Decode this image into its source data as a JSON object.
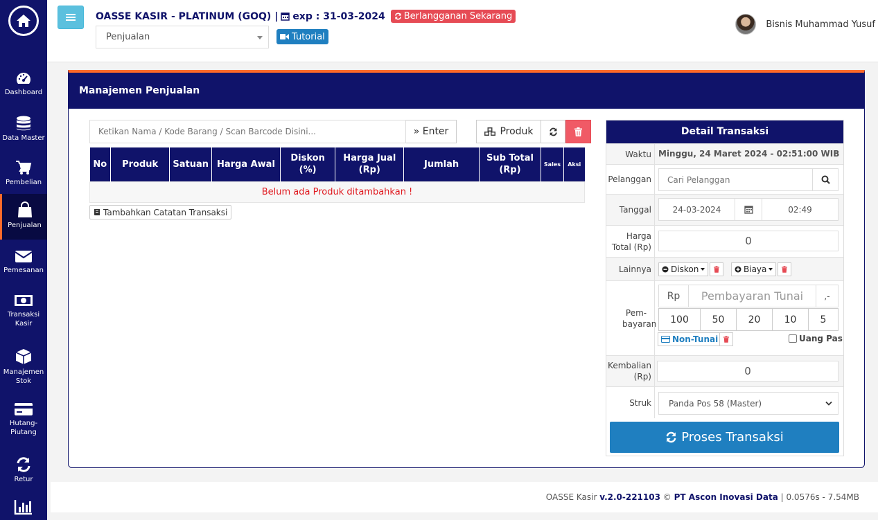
{
  "sidebar": {
    "items": [
      {
        "label": "Dashboard",
        "icon": "dashboard-icon"
      },
      {
        "label": "Data Master",
        "icon": "database-icon"
      },
      {
        "label": "Pembelian",
        "icon": "cart-icon"
      },
      {
        "label": "Penjualan",
        "icon": "shopping-bag-icon"
      },
      {
        "label": "Pemesanan",
        "icon": "envelope-icon"
      },
      {
        "label": "Transaksi Kasir",
        "icon": "money-icon"
      },
      {
        "label": "Manajemen Stok",
        "icon": "cube-icon"
      },
      {
        "label": "Hutang-Piutang",
        "icon": "credit-card-icon"
      },
      {
        "label": "Retur",
        "icon": "refresh-icon"
      },
      {
        "label": "",
        "icon": "bar-chart-icon"
      }
    ]
  },
  "topbar": {
    "title": "OASSE KASIR - PLATINUM (GOQ) |",
    "exp": "exp : 31-03-2024",
    "subscribe": "Berlangganan Sekarang",
    "module_select": "Penjualan",
    "tutorial": "Tutorial",
    "user_name": "Bisnis Muhammad Yusuf"
  },
  "panel": {
    "title": "Manajemen Penjualan",
    "search_placeholder": "Ketikan Nama / Kode Barang / Scan Barcode Disini...",
    "enter_label": "» Enter",
    "produk_label": "Produk",
    "table": {
      "headers": [
        "No",
        "Produk",
        "Satuan",
        "Harga Awal",
        "Diskon (%)",
        "Harga Jual (Rp)",
        "Jumlah",
        "Sub Total (Rp)",
        "Sales",
        "Aksi"
      ],
      "empty_message": "Belum ada Produk ditambahkan !"
    },
    "note_button": "Tambahkan Catatan Transaksi"
  },
  "detail": {
    "title": "Detail Transaksi",
    "waktu_label": "Waktu",
    "waktu_value": "Minggu, 24 Maret 2024 - 02:51:00 WIB",
    "pelanggan_label": "Pelanggan",
    "pelanggan_placeholder": "Cari Pelanggan",
    "tanggal_label": "Tanggal",
    "tanggal_value": "24-03-2024",
    "jam_value": "02:49",
    "harga_total_label": "Harga Total (Rp)",
    "harga_total_value": "0",
    "lainnya_label": "Lainnya",
    "diskon_label": "Diskon",
    "biaya_label": "Biaya",
    "pembayaran_label": "Pem-bayaran",
    "rp_prefix": "Rp",
    "pembayaran_placeholder": "Pembayaran Tunai",
    "rp_suffix": ",-",
    "quick_amounts": [
      "100",
      "50",
      "20",
      "10",
      "5"
    ],
    "non_tunai_label": "Non-Tunai",
    "uang_pas_label": "Uang Pas",
    "kembalian_label": "Kembalian (Rp)",
    "kembalian_value": "0",
    "struk_label": "Struk",
    "struk_value": "Panda Pos 58 (Master)",
    "proses_label": "Proses Transaksi"
  },
  "footer": {
    "app": "OASSE Kasir",
    "version": "v.2.0-221103",
    "copyright": "©",
    "company": "PT Ascon Inovasi Data",
    "stats": "| 0.0576s - 7.54MB"
  },
  "colors": {
    "primary": "#10136a",
    "accent": "#ff6a2a",
    "info": "#5bc0de",
    "danger": "#e64b55",
    "blue": "#1f7fc0"
  }
}
